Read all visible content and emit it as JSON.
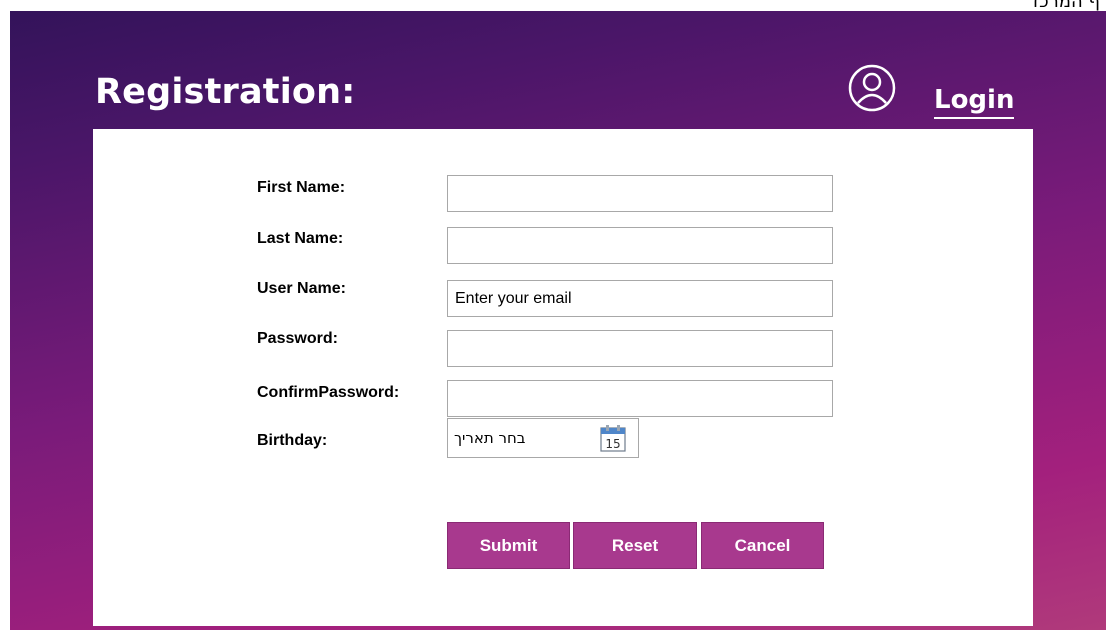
{
  "window": {
    "corner_text": "ף המרכז"
  },
  "header": {
    "title": "Registration:",
    "login_label": "Login",
    "user_icon": "user-circle-icon"
  },
  "form": {
    "first_name": {
      "label": "First Name:",
      "value": ""
    },
    "last_name": {
      "label": "Last Name:",
      "value": ""
    },
    "user_name": {
      "label": "User Name:",
      "placeholder": "Enter your email"
    },
    "password": {
      "label": "Password:",
      "value": ""
    },
    "confirm_password": {
      "label": "ConfirmPassword:",
      "value": ""
    },
    "birthday": {
      "label": "Birthday:",
      "placeholder": "בחר תאריך",
      "calendar_icon": "calendar-icon",
      "calendar_day": "15"
    }
  },
  "buttons": {
    "submit": "Submit",
    "reset": "Reset",
    "cancel": "Cancel"
  },
  "colors": {
    "gradient_top": "#33135a",
    "gradient_bottom": "#b03a7b",
    "button": "#a8398e"
  }
}
